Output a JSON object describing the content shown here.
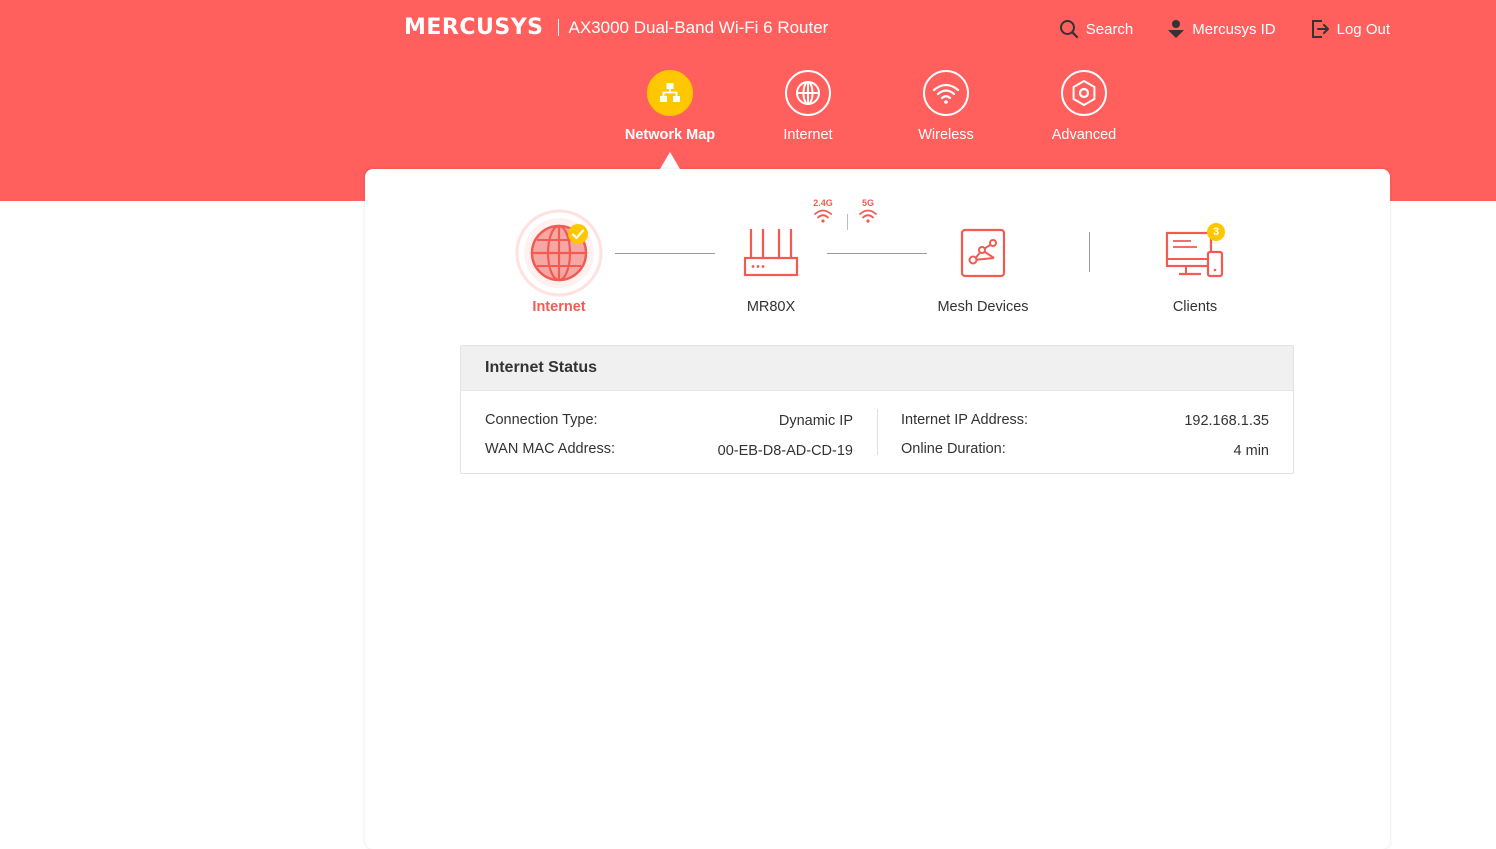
{
  "header": {
    "logo": "MERCUSYS",
    "model": "AX3000 Dual-Band Wi-Fi 6 Router",
    "actions": [
      {
        "label": "Search",
        "icon": "search-icon"
      },
      {
        "label": "Mercusys ID",
        "icon": "user-id-icon"
      },
      {
        "label": "Log Out",
        "icon": "logout-icon"
      }
    ]
  },
  "nav": {
    "tabs": [
      {
        "label": "Network Map",
        "icon": "network-map-icon",
        "active": true
      },
      {
        "label": "Internet",
        "icon": "globe-icon",
        "active": false
      },
      {
        "label": "Wireless",
        "icon": "wifi-icon",
        "active": false
      },
      {
        "label": "Advanced",
        "icon": "gear-icon",
        "active": false
      }
    ]
  },
  "topology": {
    "internet": {
      "label": "Internet",
      "status": "connected"
    },
    "router": {
      "label": "MR80X"
    },
    "bands": {
      "band_24": "2.4G",
      "band_5": "5G"
    },
    "mesh": {
      "label": "Mesh Devices"
    },
    "clients": {
      "label": "Clients",
      "count": "3"
    }
  },
  "status": {
    "title": "Internet Status",
    "left": [
      {
        "label": "Connection Type:",
        "value": "Dynamic IP"
      },
      {
        "label": "WAN MAC Address:",
        "value": "00-EB-D8-AD-CD-19"
      }
    ],
    "right": [
      {
        "label": "Internet IP Address:",
        "value": "192.168.1.35"
      },
      {
        "label": "Online Duration:",
        "value": "4 min"
      }
    ]
  },
  "colors": {
    "brand": "#ff5f5d",
    "accent_yellow": "#ffc700",
    "icon_red": "#f25a52"
  }
}
